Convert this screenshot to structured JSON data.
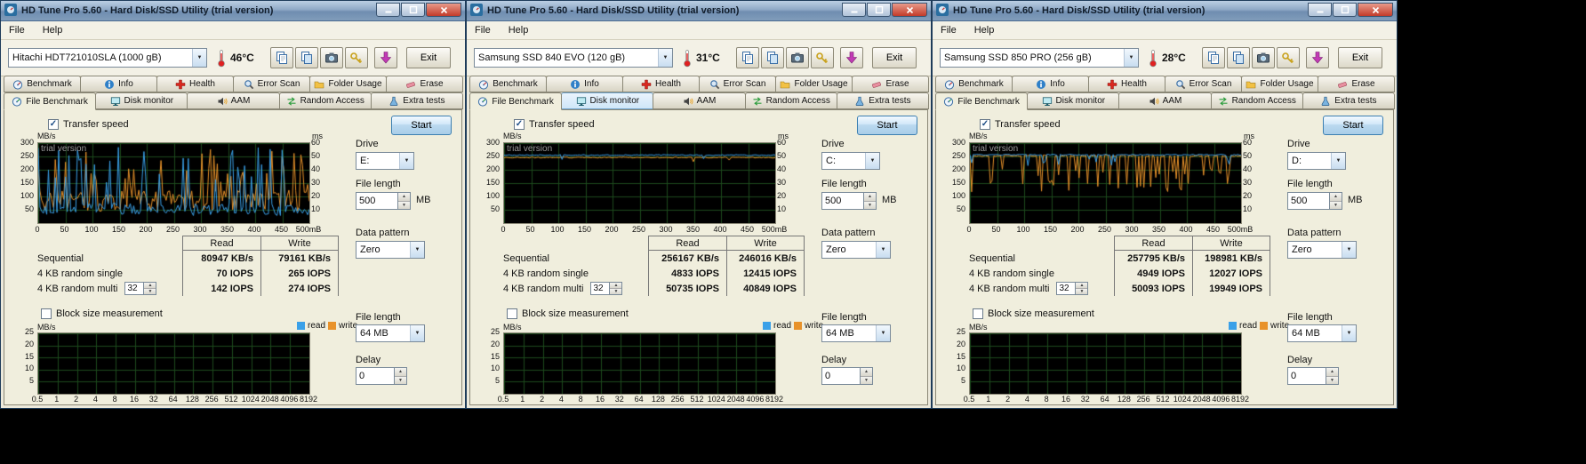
{
  "title": "HD Tune Pro 5.60 - Hard Disk/SSD Utility (trial version)",
  "menu": {
    "file": "File",
    "help": "Help"
  },
  "labels": {
    "exit": "Exit",
    "start": "Start",
    "transfer_speed": "Transfer speed",
    "drive": "Drive",
    "file_length": "File length",
    "mb": "MB",
    "data_pattern": "Data pattern",
    "block_size": "Block size measurement",
    "legend_read": "read",
    "legend_write": "write",
    "delay": "Delay",
    "read": "Read",
    "write": "Write"
  },
  "tabs1": [
    "Benchmark",
    "Info",
    "Health",
    "Error Scan",
    "Folder Usage",
    "Erase"
  ],
  "tabs2": [
    "File Benchmark",
    "Disk monitor",
    "AAM",
    "Random Access",
    "Extra tests"
  ],
  "axes": {
    "top": {
      "unit_left": "MB/s",
      "unit_right": "ms",
      "watermark": "trial version",
      "left_ticks": [
        "300",
        "250",
        "200",
        "150",
        "100",
        "50"
      ],
      "right_ticks": [
        "60",
        "50",
        "40",
        "30",
        "20",
        "10"
      ],
      "x_ticks": [
        "0",
        "50",
        "100",
        "150",
        "200",
        "250",
        "300",
        "350",
        "400",
        "450",
        "500mB"
      ]
    },
    "bottom": {
      "unit_left": "MB/s",
      "left_ticks": [
        "25",
        "20",
        "15",
        "10",
        "5"
      ],
      "x_ticks": [
        "0.5",
        "1",
        "2",
        "4",
        "8",
        "16",
        "32",
        "64",
        "128",
        "256",
        "512",
        "1024",
        "2048",
        "4096",
        "8192"
      ]
    }
  },
  "colors": {
    "read": "#3aa0e8",
    "write": "#e8922a",
    "grid": "#1d4a1d",
    "chart_bg": "#000000"
  },
  "windows": [
    {
      "drive_model": "Hitachi HDT721010SLA (1000 gB)",
      "temperature": "46°C",
      "drive_value": "E:",
      "file_length_value": "500",
      "data_pattern_value": "Zero",
      "queue_depth": "32",
      "results": {
        "rows": [
          {
            "label": "Sequential",
            "read": "80947 KB/s",
            "write": "79161 KB/s"
          },
          {
            "label": "4 KB random single",
            "read": "70 IOPS",
            "write": "265 IOPS"
          },
          {
            "label": "4 KB random multi",
            "read": "142 IOPS",
            "write": "274 IOPS"
          }
        ]
      },
      "block_file_length_value": "64 MB",
      "delay_value": "0",
      "chart": {
        "seed": 7,
        "points": 160,
        "y_max": 300,
        "read": {
          "base": 50,
          "noise": 25,
          "spike_prob": 0.2,
          "spike_min": 150,
          "spike_max": 285
        },
        "write": {
          "base": 85,
          "noise": 40,
          "spike_prob": 0.22,
          "spike_min": 140,
          "spike_max": 280
        }
      }
    },
    {
      "drive_model": "Samsung SSD 840 EVO (120 gB)",
      "temperature": "31°C",
      "drive_value": "C:",
      "file_length_value": "500",
      "data_pattern_value": "Zero",
      "queue_depth": "32",
      "highlight_tab2": 1,
      "results": {
        "rows": [
          {
            "label": "Sequential",
            "read": "256167 KB/s",
            "write": "246016 KB/s"
          },
          {
            "label": "4 KB random single",
            "read": "4833 IOPS",
            "write": "12415 IOPS"
          },
          {
            "label": "4 KB random multi",
            "read": "50735 IOPS",
            "write": "40849 IOPS"
          }
        ]
      },
      "block_file_length_value": "64 MB",
      "delay_value": "0",
      "chart": {
        "seed": 21,
        "points": 160,
        "y_max": 300,
        "read": {
          "base": 255,
          "noise": 2,
          "spike_prob": 0.02,
          "spike_min": 238,
          "spike_max": 248
        },
        "write": {
          "base": 246,
          "noise": 2,
          "spike_prob": 0.04,
          "spike_min": 228,
          "spike_max": 240
        }
      }
    },
    {
      "drive_model": "Samsung SSD 850 PRO (256 gB)",
      "temperature": "28°C",
      "drive_value": "D:",
      "file_length_value": "500",
      "data_pattern_value": "Zero",
      "queue_depth": "32",
      "results": {
        "rows": [
          {
            "label": "Sequential",
            "read": "257795 KB/s",
            "write": "198981 KB/s"
          },
          {
            "label": "4 KB random single",
            "read": "4949 IOPS",
            "write": "12027 IOPS"
          },
          {
            "label": "4 KB random multi",
            "read": "50093 IOPS",
            "write": "19949 IOPS"
          }
        ]
      },
      "block_file_length_value": "64 MB",
      "delay_value": "0",
      "chart": {
        "seed": 33,
        "points": 160,
        "y_max": 300,
        "read": {
          "base": 256,
          "noise": 2,
          "spike_prob": 0.05,
          "spike_min": 215,
          "spike_max": 240
        },
        "write": {
          "base": 252,
          "noise": 3,
          "spike_prob": 0.3,
          "spike_min": 115,
          "spike_max": 205
        }
      }
    }
  ]
}
